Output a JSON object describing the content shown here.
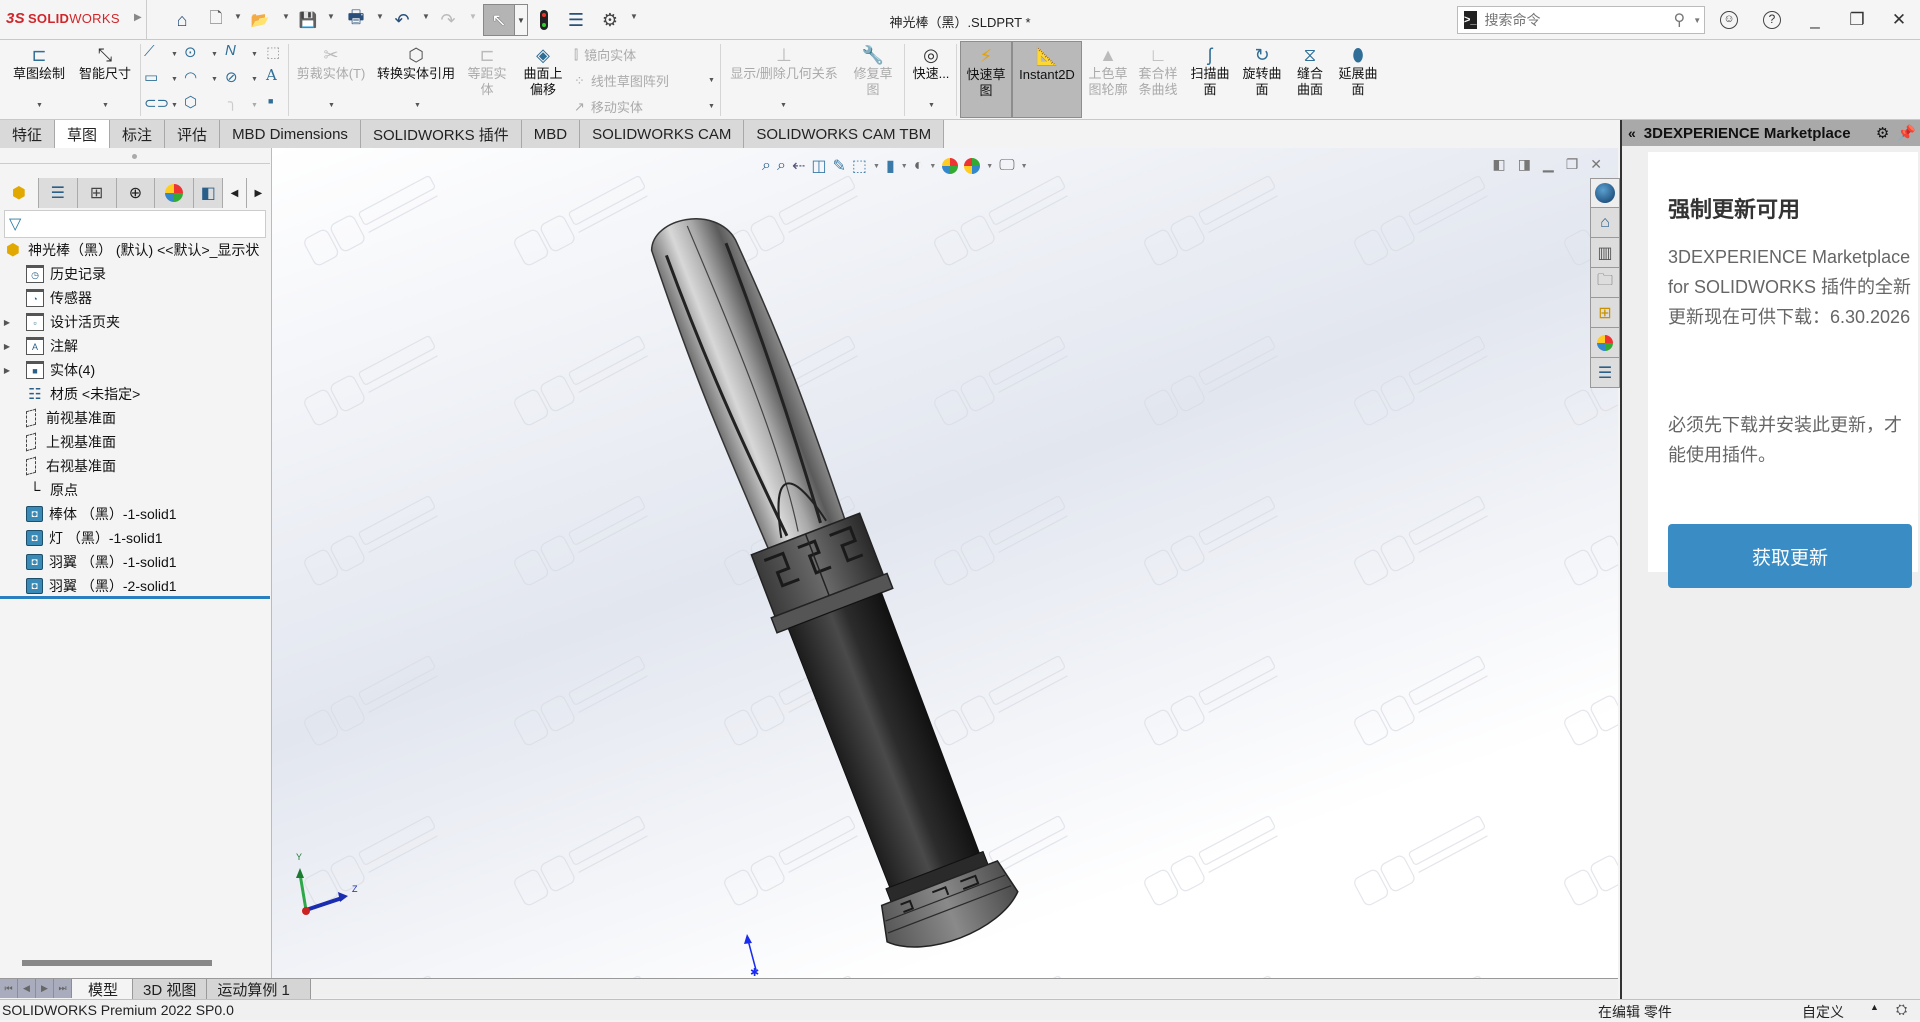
{
  "app": {
    "logo_prefix": "3S",
    "logo_bold": "SOLID",
    "logo_rest": "WORKS",
    "document_title": "神光棒（黑）.SLDPRT *"
  },
  "quick_access": [
    {
      "name": "home-icon",
      "glyph": "⌂"
    },
    {
      "name": "new-document-icon",
      "glyph": "🗋"
    },
    {
      "name": "open-icon",
      "glyph": "📂"
    },
    {
      "name": "save-icon",
      "glyph": "💾"
    },
    {
      "name": "print-icon",
      "glyph": "🖶"
    },
    {
      "name": "undo-icon",
      "glyph": "↶"
    },
    {
      "name": "redo-icon",
      "glyph": "↷"
    },
    {
      "name": "select-icon",
      "glyph": "↖"
    },
    {
      "name": "rebuild-icon",
      "glyph": "🚦"
    },
    {
      "name": "file-properties-icon",
      "glyph": "☰"
    },
    {
      "name": "options-icon",
      "glyph": "⚙"
    }
  ],
  "search": {
    "placeholder": "搜索命令"
  },
  "window_controls": {
    "user": "☺",
    "help": "?",
    "minimize": "_",
    "restore": "❐",
    "close": "✕"
  },
  "commands": {
    "sketch": "草图绘制",
    "smart_dimension": "智能尺寸",
    "trim": "剪裁实体(T)",
    "convert": "转换实体引用",
    "offset_line1": "等距实",
    "offset_line2": "体",
    "offset_surface_line1": "曲面上",
    "offset_surface_line2": "偏移",
    "mirror": "镜向实体",
    "linear_pattern": "线性草图阵列",
    "move": "移动实体",
    "relations": "显示/删除几何关系",
    "repair_line1": "修复草",
    "repair_line2": "图",
    "quick_snaps": "快速...",
    "rapid_sketch_line1": "快速草",
    "rapid_sketch_line2": "图",
    "instant2d": "Instant2D",
    "shaded_line1": "上色草",
    "shaded_line2": "图轮廓",
    "fit_spline_line1": "套合样",
    "fit_spline_line2": "条曲线",
    "sweep_line1": "扫描曲",
    "sweep_line2": "面",
    "revolve_line1": "旋转曲",
    "revolve_line2": "面",
    "knit_line1": "缝合",
    "knit_line2": "曲面",
    "extend_line1": "延展曲",
    "extend_line2": "面"
  },
  "tabs": [
    "特征",
    "草图",
    "标注",
    "评估",
    "MBD Dimensions",
    "SOLIDWORKS 插件",
    "MBD",
    "SOLIDWORKS CAM",
    "SOLIDWORKS CAM TBM"
  ],
  "active_tab": "草图",
  "feature_tree": {
    "root": "神光棒（黑） (默认) <<默认>_显示状",
    "items": [
      {
        "label": "历史记录",
        "icon": "history-folder-icon",
        "glyph": "◷",
        "expandable": false
      },
      {
        "label": "传感器",
        "icon": "sensors-folder-icon",
        "glyph": "◔",
        "expandable": false
      },
      {
        "label": "设计活页夹",
        "icon": "design-binder-icon",
        "glyph": "▫",
        "expandable": true
      },
      {
        "label": "注解",
        "icon": "annotations-icon",
        "glyph": "A",
        "expandable": true
      },
      {
        "label": "实体(4)",
        "icon": "solid-bodies-folder-icon",
        "glyph": "■",
        "expandable": true
      },
      {
        "label": "材质 <未指定>",
        "icon": "material-icon",
        "glyph": "☷",
        "expandable": false
      },
      {
        "label": "前视基准面",
        "icon": "plane-icon",
        "glyph": "",
        "expandable": false
      },
      {
        "label": "上视基准面",
        "icon": "plane-icon",
        "glyph": "",
        "expandable": false
      },
      {
        "label": "右视基准面",
        "icon": "plane-icon",
        "glyph": "",
        "expandable": false
      },
      {
        "label": "原点",
        "icon": "origin-icon",
        "glyph": "└",
        "expandable": false
      },
      {
        "label": "棒体 （黑）-1-solid1",
        "icon": "solid-body-icon",
        "glyph": "◘",
        "expandable": false
      },
      {
        "label": "灯 （黑）-1-solid1",
        "icon": "solid-body-icon",
        "glyph": "◘",
        "expandable": false
      },
      {
        "label": "羽翼 （黑）-1-solid1",
        "icon": "solid-body-icon",
        "glyph": "◘",
        "expandable": false
      },
      {
        "label": "羽翼 （黑）-2-solid1",
        "icon": "solid-body-icon",
        "glyph": "◘",
        "expandable": false
      }
    ]
  },
  "triad": {
    "y": "Y",
    "z": "Z"
  },
  "marketplace": {
    "header": "3DEXPERIENCE Marketplace",
    "title": "强制更新可用",
    "body1": "3DEXPERIENCE Marketplace for SOLIDWORKS 插件的全新更新现在可供下载：6.30.2026",
    "body2": "必须先下载并安装此更新，才能使用插件。",
    "button": "获取更新",
    "accent": "#3a8dc4"
  },
  "bottom_tabs": [
    "模型",
    "3D 视图",
    "运动算例 1"
  ],
  "status": {
    "version": "SOLIDWORKS Premium 2022 SP0.0",
    "mode": "在编辑 零件",
    "units": "自定义"
  }
}
